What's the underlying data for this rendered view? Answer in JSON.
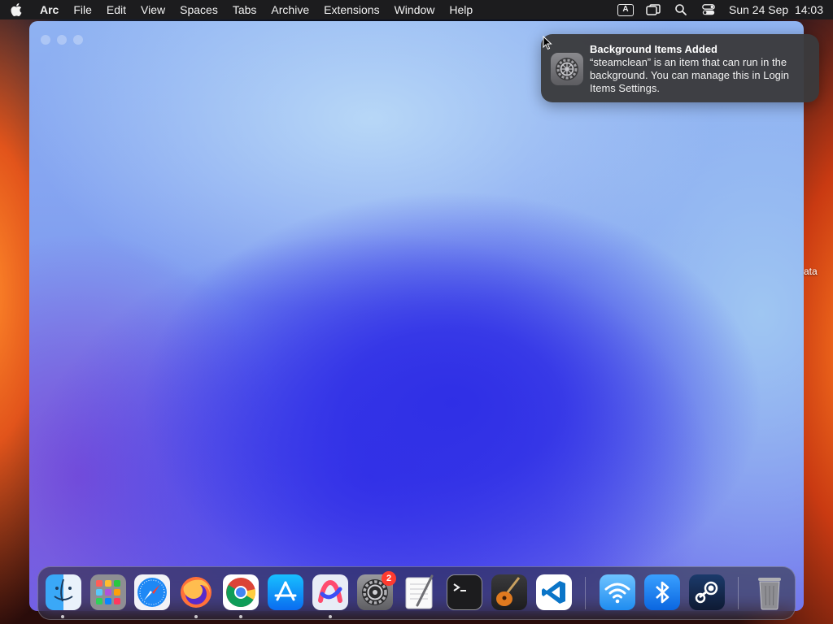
{
  "menubar": {
    "apple_icon": "apple-logo-icon",
    "app_name": "Arc",
    "items": [
      "File",
      "Edit",
      "View",
      "Spaces",
      "Tabs",
      "Archive",
      "Extensions",
      "Window",
      "Help"
    ],
    "input_source": "A",
    "status_icons": [
      "input-source-icon",
      "screen-mirroring-icon",
      "spotlight-search-icon",
      "control-center-icon"
    ],
    "date": "Sun 24 Sep",
    "time": "14:03"
  },
  "notification": {
    "icon": "system-settings-gear-icon",
    "title": "Background Items Added",
    "body": "“steamclean” is an item that can run in the background. You can manage this in Login Items Settings."
  },
  "desktop": {
    "partial_label": "ata"
  },
  "dock": {
    "apps": [
      {
        "name": "Finder",
        "icon": "finder-icon",
        "running": true
      },
      {
        "name": "Launchpad",
        "icon": "launchpad-icon",
        "running": false
      },
      {
        "name": "Safari",
        "icon": "safari-icon",
        "running": false
      },
      {
        "name": "Firefox",
        "icon": "firefox-icon",
        "running": true
      },
      {
        "name": "Google Chrome",
        "icon": "chrome-icon",
        "running": true
      },
      {
        "name": "App Store",
        "icon": "app-store-icon",
        "running": false
      },
      {
        "name": "Arc",
        "icon": "arc-browser-icon",
        "running": true
      },
      {
        "name": "System Settings",
        "icon": "system-settings-icon",
        "running": false,
        "badge": "2"
      },
      {
        "name": "TextEdit",
        "icon": "textedit-icon",
        "running": false
      },
      {
        "name": "Terminal",
        "icon": "terminal-icon",
        "running": false
      },
      {
        "name": "GarageBand",
        "icon": "garageband-icon",
        "running": false
      },
      {
        "name": "Visual Studio Code",
        "icon": "vscode-icon",
        "running": false
      },
      {
        "name": "Wi-Fi",
        "icon": "wifi-icon",
        "running": false
      },
      {
        "name": "Bluetooth",
        "icon": "bluetooth-icon",
        "running": false
      },
      {
        "name": "Steam",
        "icon": "steam-icon",
        "running": false
      },
      {
        "name": "Trash",
        "icon": "trash-icon",
        "running": false
      }
    ]
  },
  "colors": {
    "menubar_bg": "#1c1c1e",
    "notification_bg": "#3a3a3c",
    "badge": "#ff3b30"
  }
}
